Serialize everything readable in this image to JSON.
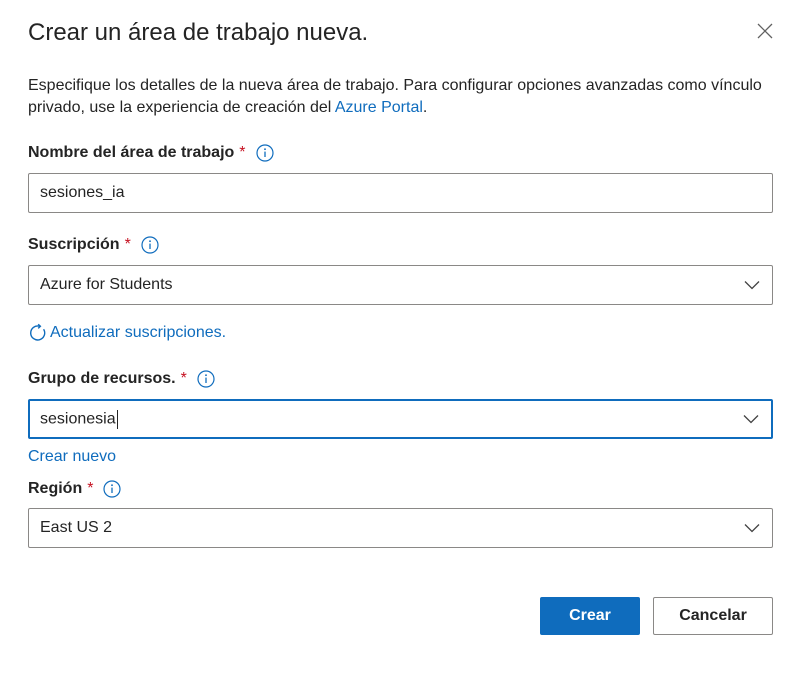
{
  "dialog": {
    "title": "Crear un área de trabajo nueva.",
    "description_text": "Especifique los detalles de la nueva área de trabajo. Para configurar opciones avanzadas como vínculo privado, use la experiencia de creación del ",
    "description_link": "Azure Portal",
    "description_end": "."
  },
  "fields": {
    "workspace_name": {
      "label": "Nombre del área de trabajo",
      "required_mark": "*",
      "value": "sesiones_ia"
    },
    "subscription": {
      "label": "Suscripción",
      "required_mark": "*",
      "value": "Azure for Students",
      "refresh_link": "Actualizar suscripciones."
    },
    "resource_group": {
      "label": "Grupo de recursos.",
      "required_mark": "*",
      "value": "sesionesia",
      "create_new_link": "Crear nuevo"
    },
    "region": {
      "label": "Región",
      "required_mark": "*",
      "value": "East US 2"
    }
  },
  "buttons": {
    "create": "Crear",
    "cancel": "Cancelar"
  },
  "colors": {
    "accent": "#0f6cbd",
    "required": "#c50f1f",
    "border": "#8a8886",
    "text": "#242424"
  },
  "icons": {
    "close": "close-icon",
    "info": "info-icon",
    "chevron": "chevron-down-icon",
    "refresh": "refresh-icon"
  }
}
